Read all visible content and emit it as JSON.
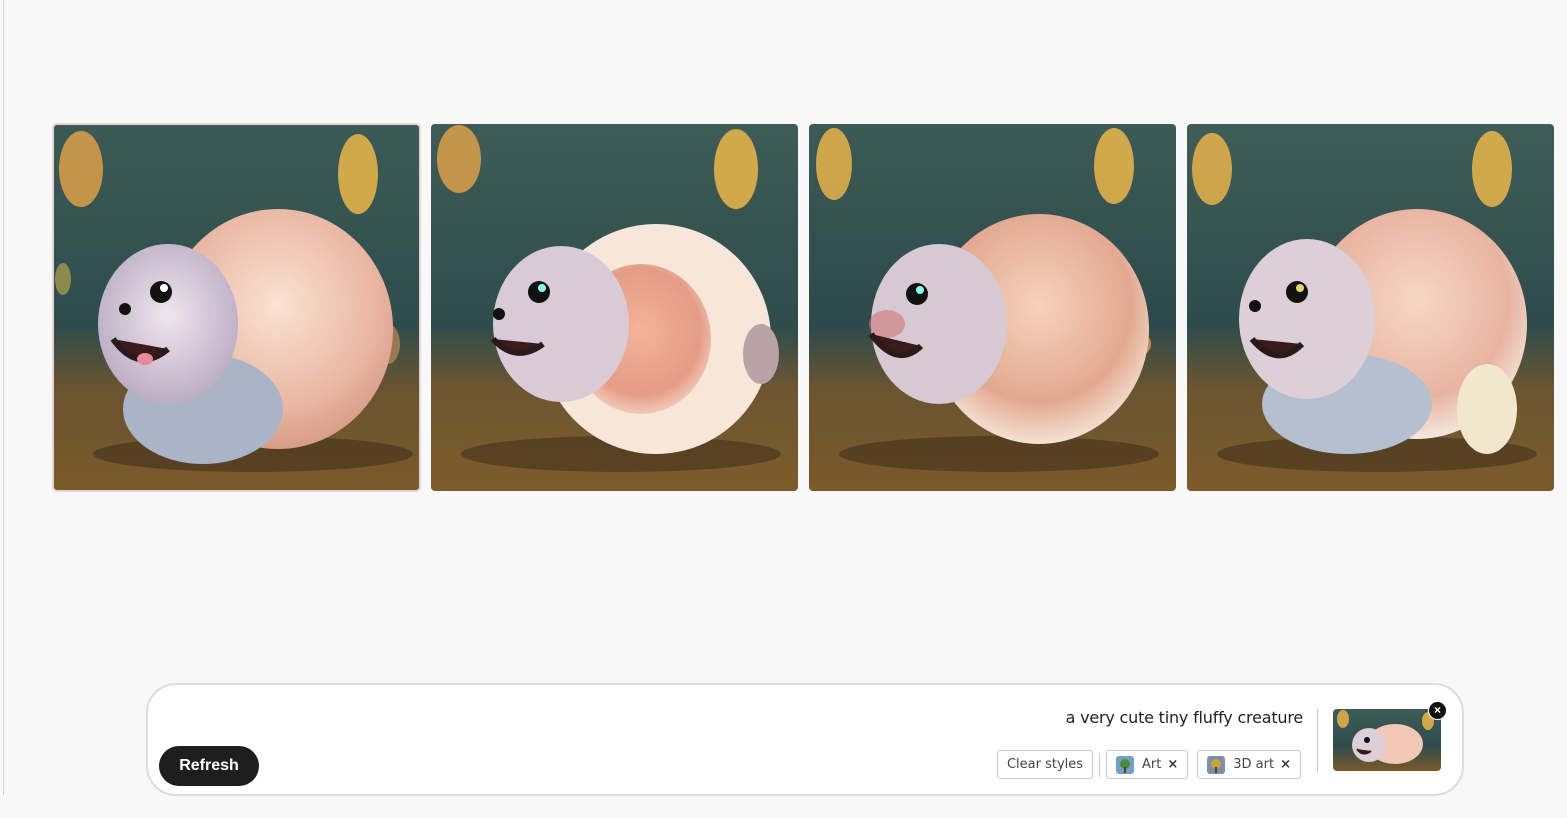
{
  "gallery": {
    "images": [
      {
        "name": "generated-image-1",
        "selected": true
      },
      {
        "name": "generated-image-2",
        "selected": false
      },
      {
        "name": "generated-image-3",
        "selected": false
      },
      {
        "name": "generated-image-4",
        "selected": false
      }
    ]
  },
  "prompt_bar": {
    "refresh_label": "Refresh",
    "prompt_text": "a very cute tiny fluffy creature",
    "clear_styles_label": "Clear styles",
    "style_chips": [
      {
        "label": "Art",
        "remove_glyph": "×",
        "icon": "art-style-icon"
      },
      {
        "label": "3D art",
        "remove_glyph": "×",
        "icon": "3d-art-style-icon"
      }
    ],
    "reference_close_glyph": "×"
  },
  "colors": {
    "background": "#f8f8f8",
    "button_dark": "#1e1e1e",
    "chip_border": "#c9c9c9"
  }
}
